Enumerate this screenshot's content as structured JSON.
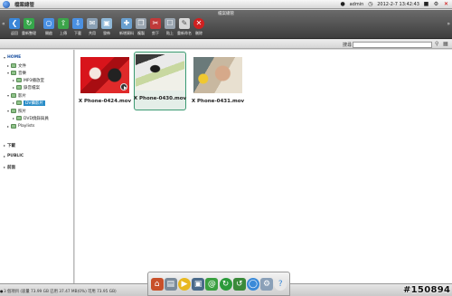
{
  "app": {
    "title": "檔案總管"
  },
  "system": {
    "user": "admin",
    "datetime": "2012-2-7 13:42:43"
  },
  "toolbar": {
    "window_title": "檔案總管",
    "items": [
      {
        "label": "返回",
        "icon": "back-arrow-icon",
        "color": "#3a86d8"
      },
      {
        "label": "重新整理",
        "icon": "refresh-icon",
        "color": "#35a64a"
      },
      {
        "label": "開啟",
        "icon": "open-icon",
        "color": "#4a90e2"
      },
      {
        "label": "上傳",
        "icon": "upload-icon",
        "color": "#3ca44a"
      },
      {
        "label": "下載",
        "icon": "download-icon",
        "color": "#4a90e2"
      },
      {
        "label": "共用",
        "icon": "share-icon",
        "color": "#8aa0b5"
      },
      {
        "label": "發佈",
        "icon": "publish-icon",
        "color": "#8fb8d8"
      },
      {
        "label": "新增資料",
        "icon": "new-folder-icon",
        "color": "#6aa0d0"
      },
      {
        "label": "複製",
        "icon": "copy-icon",
        "color": "#9aa5b0"
      },
      {
        "label": "剪下",
        "icon": "cut-icon",
        "color": "#c03a3a"
      },
      {
        "label": "貼上",
        "icon": "paste-icon",
        "color": "#9aa5b0"
      },
      {
        "label": "重新命名",
        "icon": "rename-icon",
        "color": "#d8d8d8"
      },
      {
        "label": "刪除",
        "icon": "delete-icon",
        "color": "#d02020"
      }
    ]
  },
  "search": {
    "label": "搜尋",
    "value": ""
  },
  "sidebar": {
    "root": "HOME",
    "items": [
      {
        "label": "文件",
        "level": 1
      },
      {
        "label": "音樂",
        "level": 1
      },
      {
        "label": "MP3播放室",
        "level": 2
      },
      {
        "label": "錄音檔案",
        "level": 2
      },
      {
        "label": "影片",
        "level": 1
      },
      {
        "label": "DV攝影片",
        "level": 2
      },
      {
        "label": "照片",
        "level": 1
      },
      {
        "label": "DVD燒錄與員",
        "level": 2
      },
      {
        "label": "Playlists",
        "level": 1
      }
    ],
    "bottom": [
      "下載",
      "PUBLIC",
      "前面"
    ]
  },
  "files": [
    {
      "name": "X Phone-0424.mov",
      "selected": false
    },
    {
      "name": "X Phone-0430.mov",
      "selected": true
    },
    {
      "name": "X Phone-0431.mov",
      "selected": false
    }
  ],
  "status": {
    "text": "3 個項目 (容量 73.99 GB 已用 37.47 MB(0%) 可用 73.95 GB)"
  },
  "watermark": "#150894"
}
